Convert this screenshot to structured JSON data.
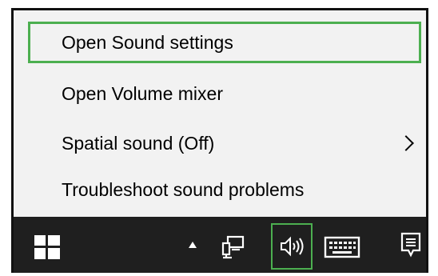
{
  "menu": {
    "items": [
      {
        "label": "Open Sound settings",
        "highlighted": true
      },
      {
        "label": "Open Volume mixer"
      },
      {
        "label": "Spatial sound (Off)",
        "has_submenu": true
      },
      {
        "label": "Troubleshoot sound problems"
      }
    ]
  },
  "taskbar": {
    "icons": [
      "windows-start-icon",
      "show-hidden-icons-arrow",
      "network-icon",
      "volume-icon",
      "touch-keyboard-icon",
      "action-center-icon"
    ]
  },
  "colors": {
    "menu_background": "#f2f2f2",
    "taskbar_background": "#1f1f1f",
    "highlight_border": "#4caf50"
  }
}
